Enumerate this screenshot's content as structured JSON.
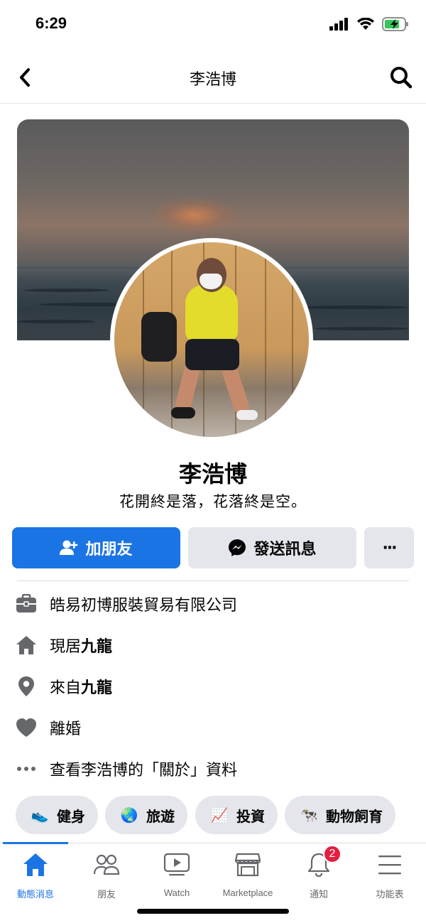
{
  "status_bar": {
    "time": "6:29"
  },
  "header": {
    "title": "李浩博",
    "back_icon": "chevron-left-icon",
    "search_icon": "search-icon"
  },
  "profile": {
    "name": "李浩博",
    "bio": "花開終是落，花落終是空。"
  },
  "actions": {
    "add_friend": "加朋友",
    "send_message": "發送訊息",
    "more": "···"
  },
  "info": {
    "work": "皓易初博服裝貿易有限公司",
    "lives_prefix": "現居",
    "lives_place": "九龍",
    "from_prefix": "來自",
    "from_place": "九龍",
    "relationship": "離婚",
    "about_link": "查看李浩博的「關於」資料"
  },
  "interests": [
    {
      "label": "健身",
      "icon": "sneaker-icon",
      "emoji": "👟"
    },
    {
      "label": "旅遊",
      "icon": "globe-icon",
      "emoji": "🌏"
    },
    {
      "label": "投資",
      "icon": "chart-up-icon",
      "emoji": "📈"
    },
    {
      "label": "動物飼育",
      "icon": "cow-icon",
      "emoji": "🐄"
    }
  ],
  "tabs": [
    {
      "label": "動態消息",
      "icon": "home-icon",
      "active": true
    },
    {
      "label": "朋友",
      "icon": "friends-icon"
    },
    {
      "label": "Watch",
      "icon": "watch-icon"
    },
    {
      "label": "Marketplace",
      "icon": "marketplace-icon"
    },
    {
      "label": "通知",
      "icon": "bell-icon",
      "badge": "2"
    },
    {
      "label": "功能表",
      "icon": "menu-icon"
    }
  ],
  "colors": {
    "accent": "#1b74e4",
    "badge": "#e41e3f",
    "chip_bg": "#e4e6eb",
    "text": "#050505",
    "muted": "#65676b"
  }
}
